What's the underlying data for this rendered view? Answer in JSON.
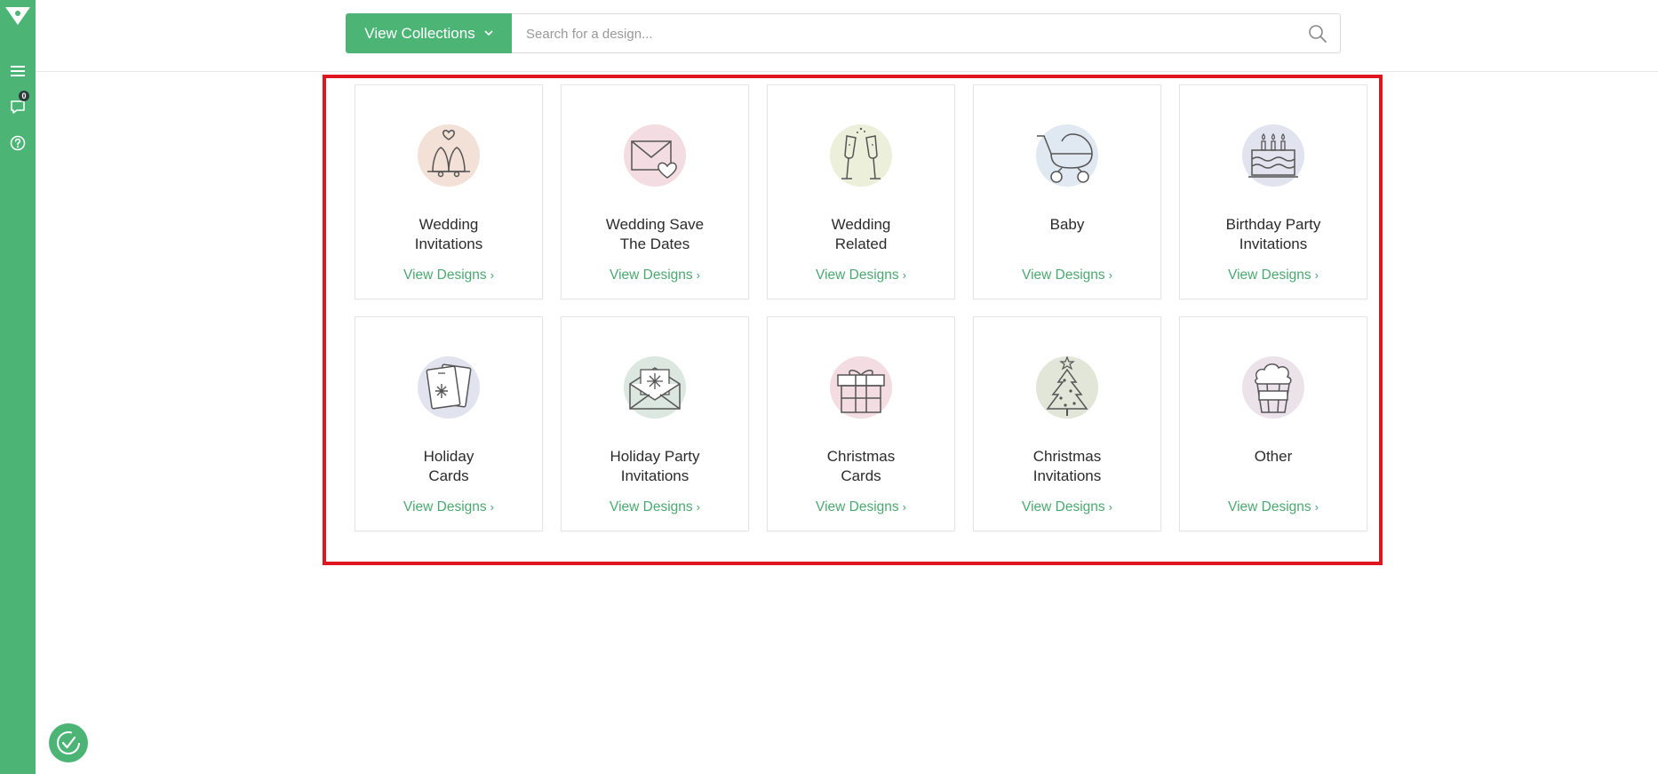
{
  "sidebar": {
    "logo": "logo-icon",
    "menu_icon": "hamburger-icon",
    "messages_icon": "chat-icon",
    "messages_badge": "0",
    "help_icon": "question-icon"
  },
  "header": {
    "collections_label": "View Collections",
    "search_placeholder": "Search for a design..."
  },
  "cards": [
    {
      "title": "Wedding\nInvitations",
      "link": "View Designs",
      "icon": "wedding-bells-icon",
      "tint": "#f3e0d6"
    },
    {
      "title": "Wedding Save\nThe Dates",
      "link": "View Designs",
      "icon": "envelope-heart-icon",
      "tint": "#f3dde2"
    },
    {
      "title": "Wedding\nRelated",
      "link": "View Designs",
      "icon": "champagne-glasses-icon",
      "tint": "#ecefd9"
    },
    {
      "title": "Baby",
      "link": "View Designs",
      "icon": "baby-stroller-icon",
      "tint": "#e0e8f2"
    },
    {
      "title": "Birthday Party\nInvitations",
      "link": "View Designs",
      "icon": "birthday-cake-icon",
      "tint": "#e1e4ef"
    },
    {
      "title": "Holiday\nCards",
      "link": "View Designs",
      "icon": "holiday-card-icon",
      "tint": "#e1e4ef"
    },
    {
      "title": "Holiday Party\nInvitations",
      "link": "View Designs",
      "icon": "snowflake-envelope-icon",
      "tint": "#dce8df"
    },
    {
      "title": "Christmas\nCards",
      "link": "View Designs",
      "icon": "gift-box-icon",
      "tint": "#f3dde2"
    },
    {
      "title": "Christmas\nInvitations",
      "link": "View Designs",
      "icon": "christmas-tree-icon",
      "tint": "#e1e6d8"
    },
    {
      "title": "Other",
      "link": "View Designs",
      "icon": "popcorn-icon",
      "tint": "#ece2ea"
    }
  ],
  "colors": {
    "brand_green": "#4cb576",
    "link_green": "#4aa86f",
    "highlight_red": "#e0161e"
  }
}
